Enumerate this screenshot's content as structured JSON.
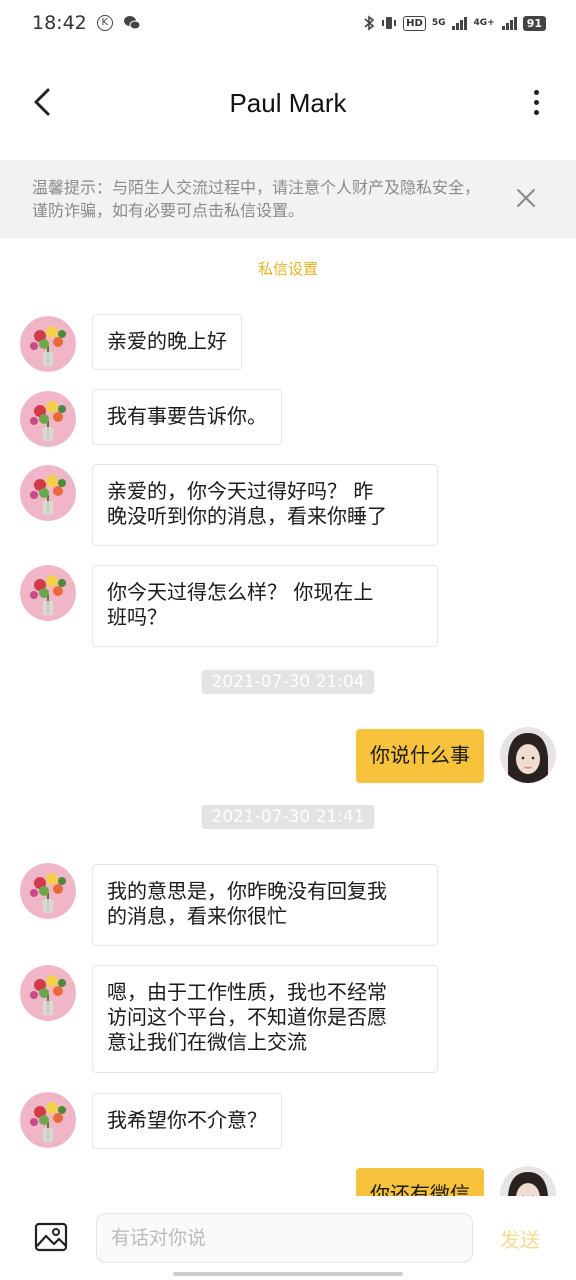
{
  "status_bar": {
    "time": "18:42",
    "icons": [
      "k-circle-icon",
      "wechat-icon",
      "bluetooth-icon",
      "vibrate-icon",
      "hd-icon",
      "signal-5g-icon",
      "signal-4g-icon",
      "battery-icon"
    ],
    "hd_label": "HD",
    "net1": "5G",
    "net2": "4G+",
    "battery": "91"
  },
  "header": {
    "title": "Paul Mark",
    "back_icon": "chevron-left-icon",
    "more_icon": "more-vertical-icon"
  },
  "banner": {
    "text": "温馨提示：与陌生人交流过程中，请注意个人财产及隐私安全，谨防诈骗，如有必要可点击私信设置。",
    "close_icon": "close-icon"
  },
  "privacy_link": "私信设置",
  "messages": [
    {
      "from": "them",
      "text": "亲爱的晚上好"
    },
    {
      "from": "them",
      "text": "我有事要告诉你。"
    },
    {
      "from": "them",
      "line1": "亲爱的，你今天过得好吗？ 昨",
      "line2": "晚没听到你的消息，看来你睡了"
    },
    {
      "from": "them",
      "line1": "你今天过得怎么样？ 你现在上",
      "line2": "班吗？"
    },
    {
      "type": "time",
      "text": "2021-07-30 21:04"
    },
    {
      "from": "me",
      "text": "你说什么事"
    },
    {
      "type": "time",
      "text": "2021-07-30 21:41"
    },
    {
      "from": "them",
      "line1": "我的意思是，你昨晚没有回复我",
      "line2": "的消息，看来你很忙"
    },
    {
      "from": "them",
      "line1": "嗯，由于工作性质，我也不经常",
      "line2": "访问这个平台，不知道你是否愿",
      "line3": "意让我们在微信上交流"
    },
    {
      "from": "them",
      "text": "我希望你不介意？"
    },
    {
      "from": "me",
      "text": "你还有微信"
    }
  ],
  "input_bar": {
    "image_icon": "image-icon",
    "placeholder": "有话对你说",
    "send_label": "发送"
  },
  "colors": {
    "accent": "#f7c23c",
    "link": "#e6b422",
    "banner_bg": "#f2f2f2"
  }
}
